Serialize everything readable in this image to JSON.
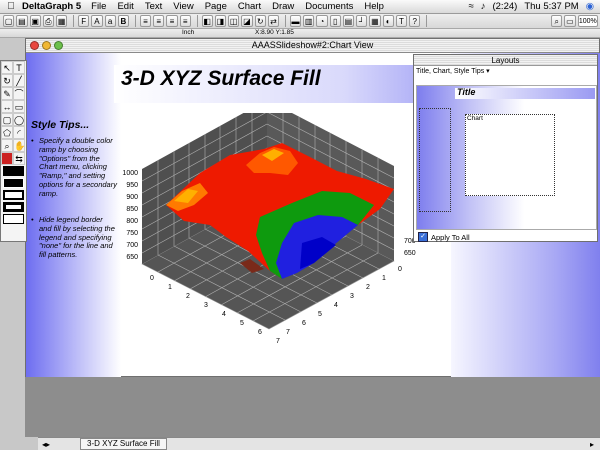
{
  "menubar": {
    "app_name": "DeltaGraph 5",
    "items": [
      "File",
      "Edit",
      "Text",
      "View",
      "Page",
      "Chart",
      "Draw",
      "Documents",
      "Help"
    ],
    "battery": "(2:24)",
    "clock": "Thu 5:37 PM"
  },
  "toolbar": {
    "zoom": "100%",
    "units": "Inch",
    "coords": "X:8.90 Y:1.85"
  },
  "window": {
    "title": "AAASSlideshow#2:Chart View"
  },
  "slide": {
    "chart_title": "3-D XYZ Surface Fill",
    "tips_title": "Style Tips...",
    "tips": [
      "Specify a double color ramp by choosing \"Options\" from the Chart menu, clicking \"Ramp,\" and setting options for a secondary ramp.",
      "Hide legend border and fill by selecting the legend and specifying \"none\" for the line and fill patterns."
    ]
  },
  "layouts": {
    "title": "Layouts",
    "selected": "Title, Chart, Style Tips",
    "preview_title": "Title",
    "preview_chart": "Chart",
    "apply_all": "Apply To All"
  },
  "status": {
    "tab_label": "3-D XYZ Surface Fill"
  },
  "chart_data": {
    "type": "surface",
    "z_ticks": [
      "1000",
      "950",
      "900",
      "850",
      "800",
      "750",
      "700",
      "650"
    ],
    "x_ticks": [
      "0",
      "1",
      "2",
      "3",
      "4",
      "5",
      "6",
      "7"
    ],
    "y_ticks": [
      "0",
      "1",
      "2",
      "3",
      "4",
      "5",
      "6",
      "7"
    ],
    "right_z_ticks": [
      "700",
      "650"
    ],
    "colors": {
      "low": "#1010e0",
      "mid": "#0e9a0e",
      "high": "#ee1a00",
      "peak": "#ffb000"
    }
  }
}
